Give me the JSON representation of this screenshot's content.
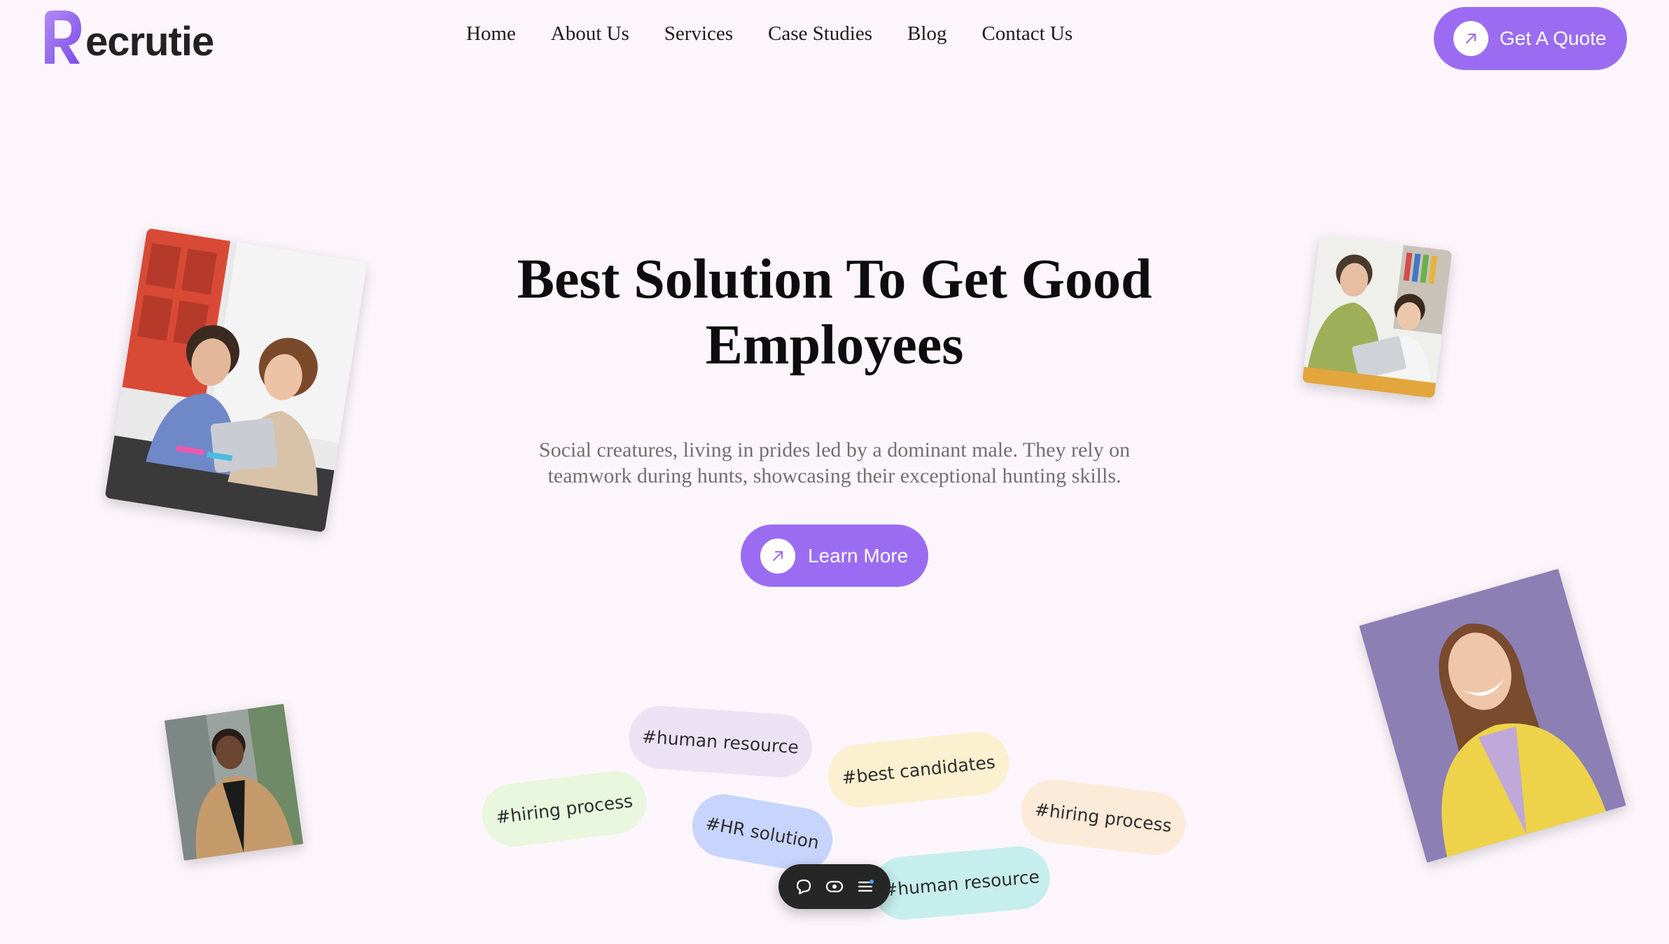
{
  "brand": {
    "logo_text": "ecrutie",
    "logo_letter": "R",
    "accent": "#9b6cf2"
  },
  "nav": {
    "items": [
      {
        "label": "Home"
      },
      {
        "label": "About Us"
      },
      {
        "label": "Services"
      },
      {
        "label": "Case Studies"
      },
      {
        "label": "Blog"
      },
      {
        "label": "Contact Us"
      }
    ]
  },
  "header": {
    "cta_label": "Get A Quote",
    "cta_icon": "arrow-up-right-icon"
  },
  "hero": {
    "title_line1": "Best Solution To Get Good",
    "title_line2": "Employees",
    "subtitle_line1": "Social creatures, living in prides led by a dominant male. They rely on",
    "subtitle_line2": "teamwork during hunts, showcasing their exceptional hunting skills.",
    "cta_label": "Learn More",
    "cta_icon": "arrow-up-right-icon"
  },
  "tags": [
    {
      "label": "#human resource",
      "color": "#ebe3f3"
    },
    {
      "label": "#best candidates",
      "color": "#fbf0cf"
    },
    {
      "label": "#hiring process",
      "color": "#e8f7de"
    },
    {
      "label": "#HR solution",
      "color": "#c7d4fb"
    },
    {
      "label": "#hiring process",
      "color": "#fcebd9"
    },
    {
      "label": "#human resource",
      "color": "#c6eeec"
    }
  ],
  "toolbar": {
    "icons": [
      "chat-bubble-icon",
      "eye-icon",
      "menu-list-icon"
    ]
  }
}
